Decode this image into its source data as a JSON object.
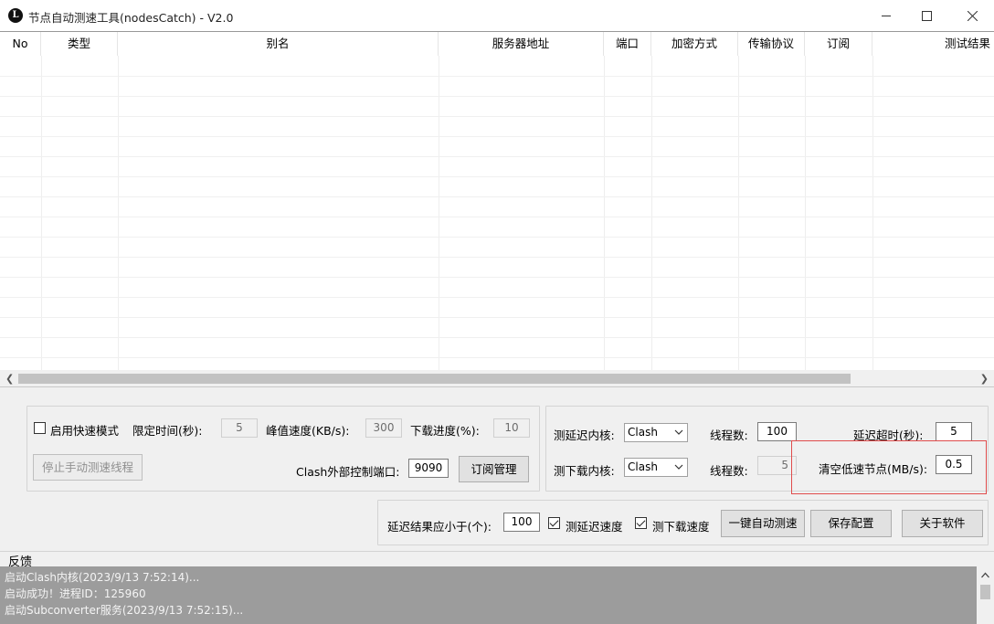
{
  "window": {
    "title": "节点自动测速工具(nodesCatch) - V2.0",
    "icon_glyph": "L"
  },
  "table": {
    "columns": [
      "No",
      "类型",
      "别名",
      "服务器地址",
      "端口",
      "加密方式",
      "传输协议",
      "订阅",
      "测试结果"
    ]
  },
  "settings": {
    "fast_mode_label": "启用快速模式",
    "fast_mode_checked": false,
    "time_limit_label": "限定时间(秒):",
    "time_limit_value": "5",
    "peak_speed_label": "峰值速度(KB/s):",
    "peak_speed_value": "300",
    "download_progress_label": "下载进度(%):",
    "download_progress_value": "10",
    "stop_button": "停止手动测速线程",
    "clash_port_label": "Clash外部控制端口:",
    "clash_port_value": "9090",
    "subscription_button": "订阅管理"
  },
  "cores": {
    "latency_core_label": "测延迟内核:",
    "latency_core_value": "Clash",
    "latency_threads_label": "线程数:",
    "latency_threads_value": "100",
    "latency_timeout_label": "延迟超时(秒):",
    "latency_timeout_value": "5",
    "download_core_label": "测下载内核:",
    "download_core_value": "Clash",
    "download_threads_label": "线程数:",
    "download_threads_value": "5",
    "clear_slow_label": "清空低速节点(MB/s):",
    "clear_slow_value": "0.5"
  },
  "actions": {
    "latency_less_label": "延迟结果应小于(个):",
    "latency_less_value": "100",
    "test_latency_label": "测延迟速度",
    "test_latency_checked": true,
    "test_download_label": "测下载速度",
    "test_download_checked": true,
    "auto_test_button": "一键自动测速",
    "save_config_button": "保存配置",
    "about_button": "关于软件"
  },
  "feedback": {
    "label": "反馈",
    "lines": [
      "启动Clash内核(2023/9/13 7:52:14)...",
      "启动成功！进程ID：125960",
      "启动Subconverter服务(2023/9/13 7:52:15)..."
    ]
  },
  "colors": {
    "highlight": "#e04b4b",
    "log_background": "#9c9c9c"
  }
}
